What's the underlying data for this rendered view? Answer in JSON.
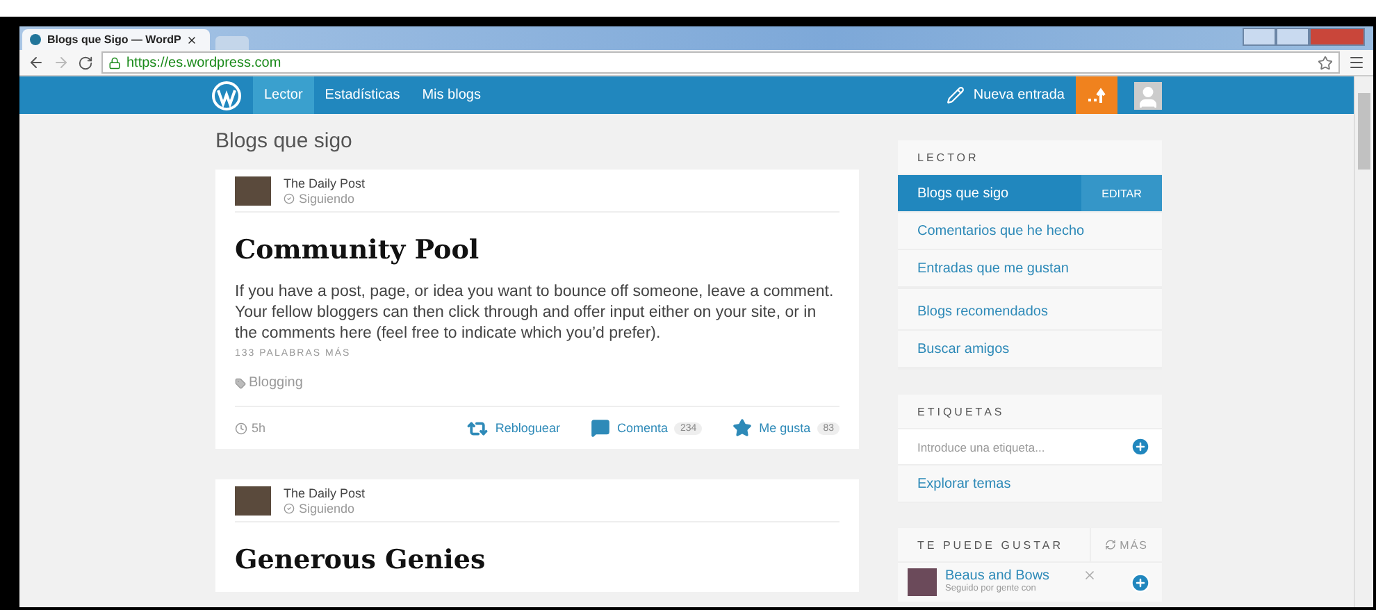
{
  "browser": {
    "tab_title": "Blogs que Sigo — WordP",
    "url": "https://es.wordpress.com"
  },
  "nav": {
    "items": [
      {
        "label": "Lector",
        "selected": true
      },
      {
        "label": "Estadísticas",
        "selected": false
      },
      {
        "label": "Mis blogs",
        "selected": false
      }
    ],
    "new_post": "Nueva entrada"
  },
  "page_title": "Blogs que sigo",
  "posts": [
    {
      "blog": "The Daily Post",
      "status": "Siguiendo",
      "title": "Community Pool",
      "excerpt": "If you have a post, page, or idea you want to bounce off someone, leave a comment. Your fellow bloggers can then click through and offer input either on your site, or in the comments here (feel free to indicate which you’d prefer).",
      "more": "133 PALABRAS MÁS",
      "tag": "Blogging",
      "time": "5h",
      "reblog": "Rebloguear",
      "comment": "Comenta",
      "comment_count": "234",
      "like": "Me gusta",
      "like_count": "83"
    },
    {
      "blog": "The Daily Post",
      "status": "Siguiendo",
      "title": "Generous Genies"
    }
  ],
  "sidebar": {
    "reader": {
      "heading": "LECTOR",
      "edit": "EDITAR",
      "groups": [
        [
          {
            "label": "Blogs que sigo",
            "selected": true
          },
          {
            "label": "Comentarios que he hecho",
            "selected": false
          },
          {
            "label": "Entradas que me gustan",
            "selected": false
          }
        ],
        [
          {
            "label": "Blogs recomendados",
            "selected": false
          },
          {
            "label": "Buscar amigos",
            "selected": false
          }
        ]
      ]
    },
    "tags": {
      "heading": "ETIQUETAS",
      "placeholder": "Introduce una etiqueta...",
      "link": "Explorar temas"
    },
    "suggestions": {
      "heading": "TE PUEDE GUSTAR",
      "more": "MÁS",
      "items": [
        {
          "name": "Beaus and Bows",
          "note": "Seguido por gente con"
        }
      ]
    }
  }
}
